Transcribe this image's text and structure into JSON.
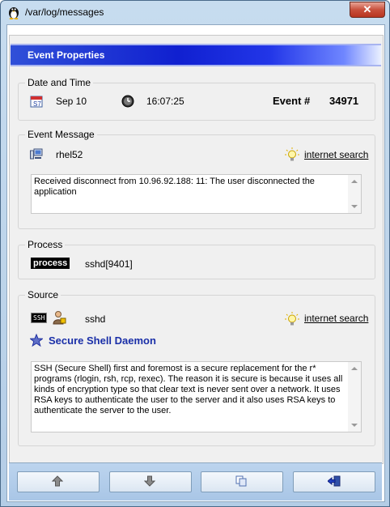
{
  "window": {
    "title": "/var/log/messages",
    "close_label": "✕"
  },
  "banner": {
    "title": "Event Properties"
  },
  "datetime": {
    "label": "Date and Time",
    "date": "Sep 10",
    "time": "16:07:25",
    "event_label": "Event #",
    "event_number": "34971"
  },
  "message": {
    "label": "Event Message",
    "host": "rhel52",
    "search_link": "internet search",
    "text": "Received disconnect from 10.96.92.188: 11: The user disconnected the application"
  },
  "process": {
    "label": "Process",
    "badge": "process",
    "value": "sshd[9401]"
  },
  "source": {
    "label": "Source",
    "ssh_badge": "SSH",
    "name": "sshd",
    "search_link": "internet search",
    "title": "Secure Shell Daemon",
    "description": "SSH (Secure Shell) first and foremost is a secure replacement for the r* programs (rlogin, rsh, rcp, rexec). The reason it is secure is because it uses all kinds of encryption type so that clear text is never sent over a network. It uses RSA keys to authenticate the user to the server and it also uses RSA keys to authenticate the server to the user."
  },
  "icons": {
    "title": "penguin-icon",
    "calendar": "calendar-icon",
    "clock": "clock-icon",
    "computer": "computer-icon",
    "bulb": "lightbulb-icon",
    "user": "user-icon",
    "star": "star-icon",
    "prev": "arrow-up-icon",
    "next": "arrow-down-icon",
    "copy": "copy-icon",
    "exit": "exit-icon"
  },
  "colors": {
    "banner": "#1020d0",
    "source_title": "#1a2fa8",
    "accent": "#3050d8"
  }
}
